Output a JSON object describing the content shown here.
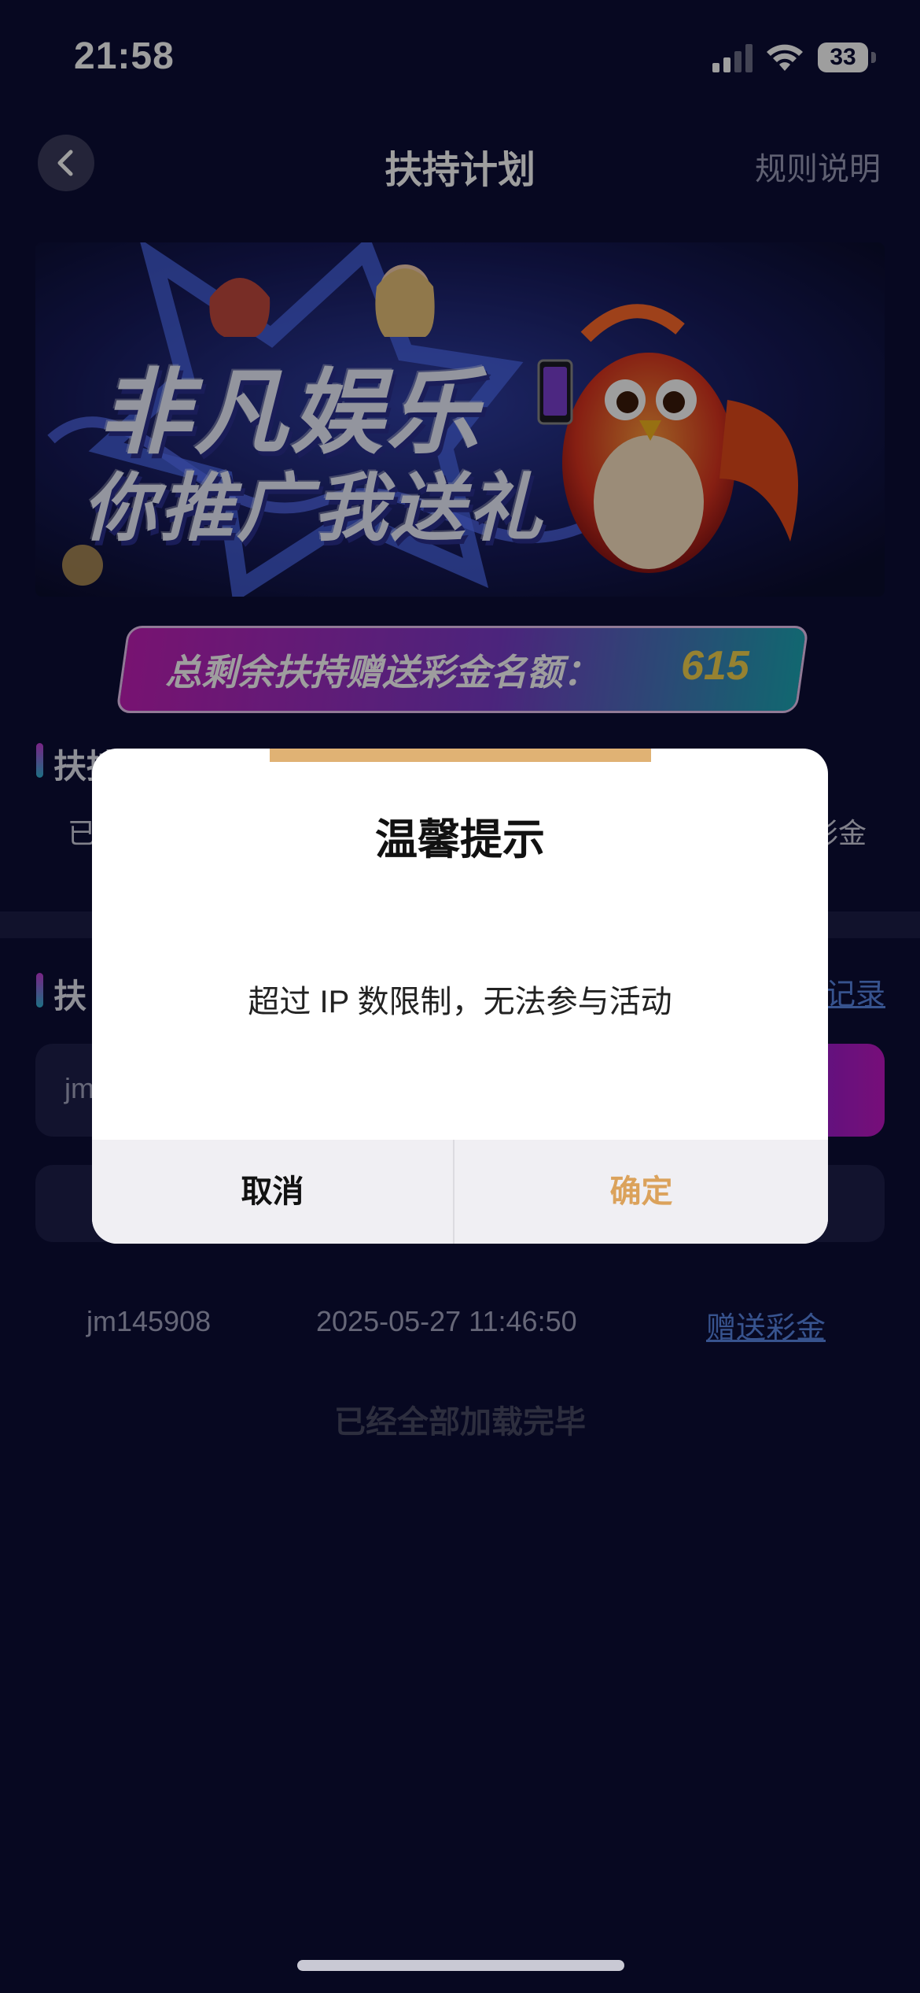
{
  "status_bar": {
    "time": "21:58",
    "battery": "33"
  },
  "header": {
    "title": "扶持计划",
    "rules_label": "规则说明"
  },
  "banner": {
    "line1": "非凡娱乐",
    "line2": "你推广我送礼"
  },
  "quota": {
    "label": "总剩余扶持赠送彩金名额：",
    "value": "615"
  },
  "section1": {
    "title_partial": "扶持赠送余额",
    "left_partial": "已",
    "right_partial": "彩金"
  },
  "section2": {
    "title_partial": "扶",
    "link_partial": "记录",
    "input_partial": "jm"
  },
  "record": {
    "user": "jm145908",
    "time": "2025-05-27 11:46:50",
    "action": "赠送彩金"
  },
  "list_footer": "已经全部加载完毕",
  "dialog": {
    "title": "温馨提示",
    "message": "超过 IP 数限制，无法参与活动",
    "cancel_label": "取消",
    "confirm_label": "确定"
  },
  "colors": {
    "background": "#0c0d36",
    "accent_gold": "#dba25b",
    "quota_value": "#f3d24f",
    "link_blue": "#5a86e6"
  }
}
